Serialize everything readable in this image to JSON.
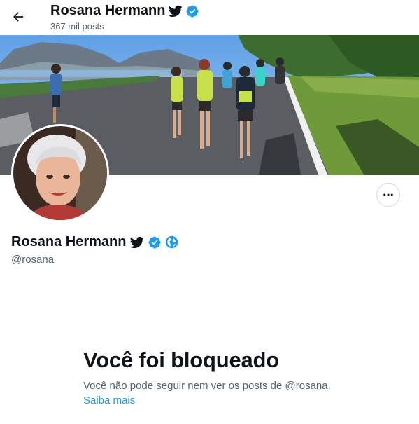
{
  "header": {
    "display_name": "Rosana Hermann",
    "post_count": "367 mil posts"
  },
  "profile": {
    "display_name": "Rosana Hermann",
    "handle": "@rosana"
  },
  "blocked_notice": {
    "title": "Você foi bloqueado",
    "description": "Você não pode seguir nem ver os posts de @rosana.",
    "link_text": "Saiba mais"
  },
  "icons": {
    "back": "arrow-left-icon",
    "bird": "twitter-bird-icon",
    "verified": "verified-badge-icon",
    "globe": "globe-icon",
    "more": "more-options-icon"
  },
  "colors": {
    "accent": "#1d9bf0",
    "text_primary": "#0f1419",
    "text_secondary": "#536471",
    "border": "#cfd9de"
  }
}
